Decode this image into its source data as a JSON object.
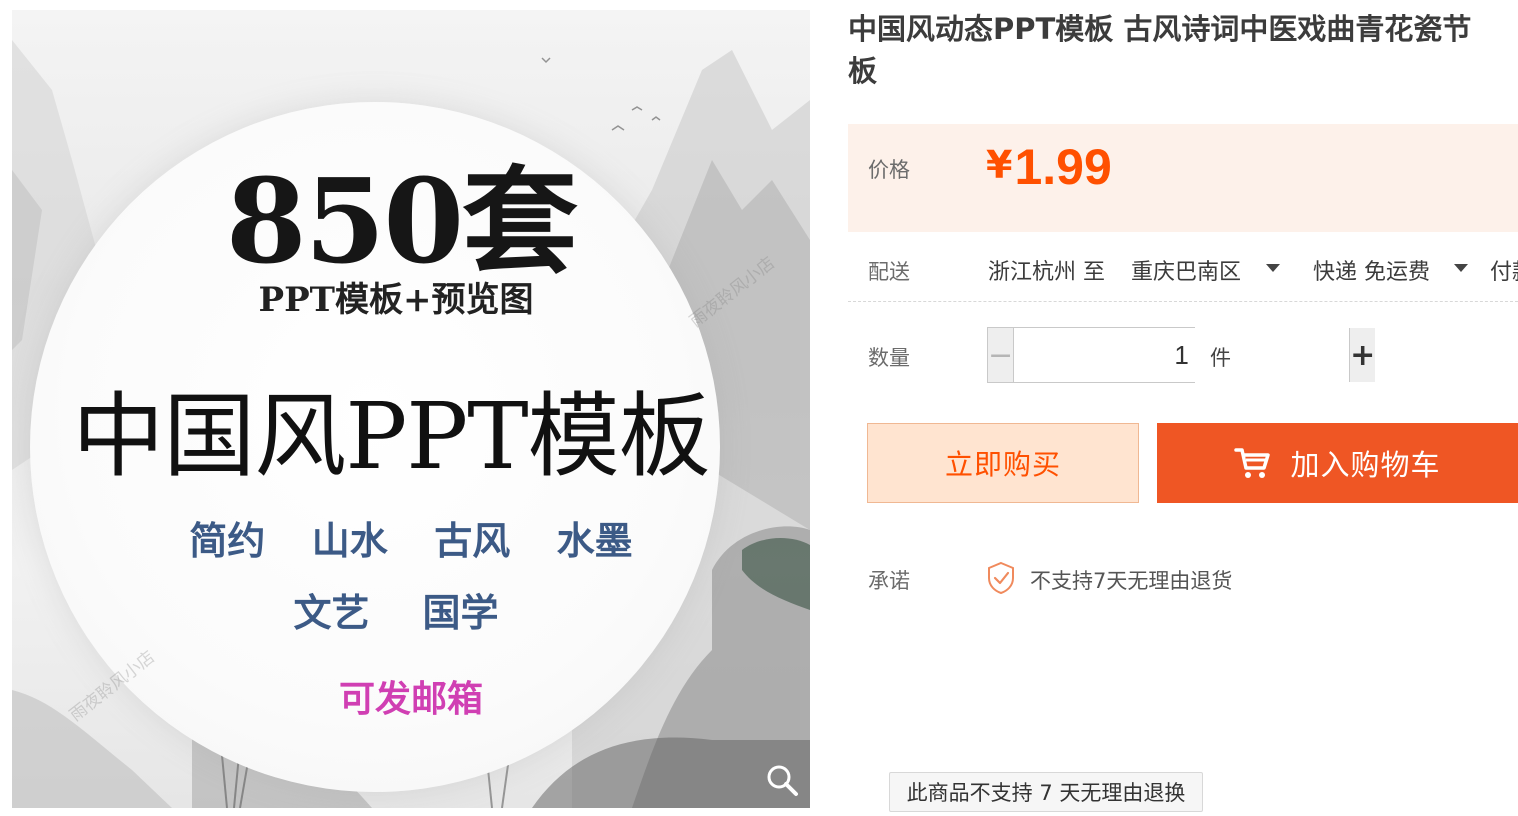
{
  "product": {
    "title_line1": "中国风动态PPT模板 古风诗词中医戏曲青花瓷节",
    "title_line2": "板"
  },
  "image": {
    "count_title": "850套",
    "sub_title": "PPT模板+预览图",
    "main_title": "中国风PPT模板",
    "tags_row1": "简约  山水  古风  水墨",
    "tags_row2": "文艺    国学",
    "email_note": "可发邮箱",
    "watermark": "雨夜聆风小店"
  },
  "price": {
    "label": "价格",
    "currency": "¥",
    "value": "1.99",
    "color": "#ff5000"
  },
  "shipping": {
    "label": "配送",
    "from": "浙江杭州 至",
    "to": "重庆巴南区",
    "method": "快递 免运费",
    "payment": "付款"
  },
  "quantity": {
    "label": "数量",
    "minus": "−",
    "value": "1",
    "plus": "+",
    "unit": "件"
  },
  "actions": {
    "buy_now": "立即购买",
    "add_cart": "加入购物车",
    "cart_icon": "cart-icon",
    "accent": "#ef5624"
  },
  "promise": {
    "label": "承诺",
    "icon": "shield-check-icon",
    "text": "不支持7天无理由退货"
  },
  "tooltip": {
    "text": "此商品不支持 7 天无理由退换"
  }
}
